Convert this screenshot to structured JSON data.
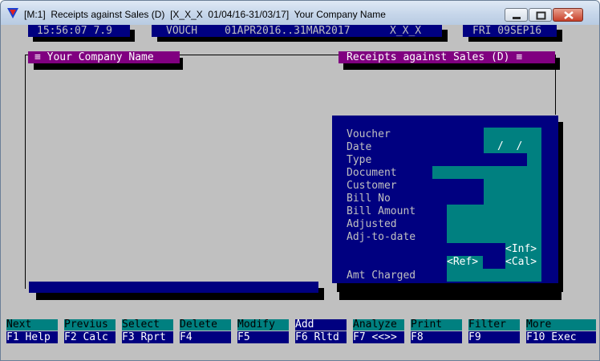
{
  "window": {
    "title": "[M:1]  Receipts against Sales (D)  [X_X_X  01/04/16-31/03/17]  Your Company Name"
  },
  "status": {
    "time": "15:56:07 7.9",
    "mode": "VOUCH",
    "period": "01APR2016..31MAR2017",
    "code": "X_X_X",
    "date": "FRI 09SEP16"
  },
  "panel": {
    "left_title": "≡ Your Company Name",
    "right_title": "Receipts against Sales (D) ≡"
  },
  "form": {
    "labels": [
      "Voucher",
      "Date",
      "Type",
      "Document",
      "Customer",
      "Bill No",
      "Bill Amount",
      "Adjusted",
      "Adj-to-date"
    ],
    "date_value": "/  /",
    "inf_button": "<Inf>",
    "ref_button": "<Ref>",
    "cal_button": "<Cal>",
    "amt_charged_label": "Amt Charged"
  },
  "fkeys": [
    {
      "action": "Next",
      "key": "F1 Help"
    },
    {
      "action": "Previus",
      "key": "F2 Calc"
    },
    {
      "action": "Select",
      "key": "F3 Rprt"
    },
    {
      "action": "Delete",
      "key": "F4"
    },
    {
      "action": "Modify",
      "key": "F5"
    },
    {
      "action": "Add",
      "key": "F6 Rltd"
    },
    {
      "action": "Analyze",
      "key": "F7 <<>>"
    },
    {
      "action": "Print",
      "key": "F8"
    },
    {
      "action": "Filter",
      "key": "F9"
    },
    {
      "action": "More",
      "key": "F10 Exec"
    }
  ],
  "colors": {
    "console_bg": "#c0c0c0",
    "navy": "#000080",
    "teal": "#008080",
    "purple": "#800080"
  }
}
